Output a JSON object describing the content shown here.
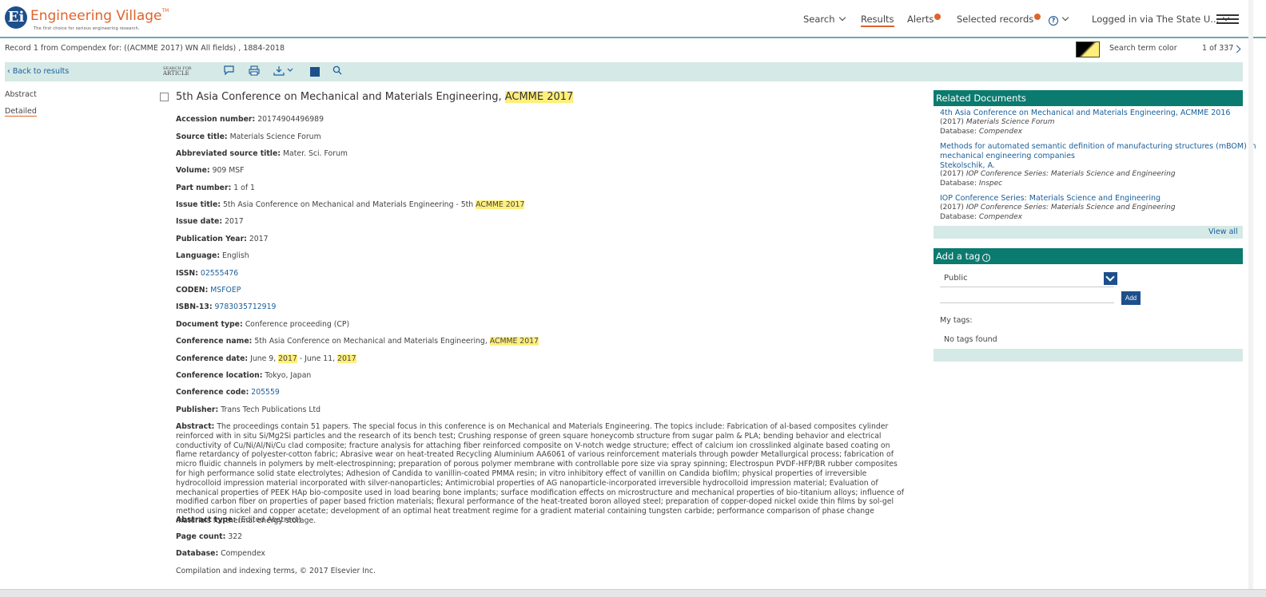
{
  "header": {
    "logo_text": "Engineering Village",
    "logo_mark": "TM",
    "tagline": "The first choice for serious engineering research.",
    "nav": {
      "search": "Search",
      "results": "Results",
      "alerts": "Alerts",
      "selected_records": "Selected records",
      "help": "?",
      "login": "Logged in via The State U..."
    }
  },
  "record_bar": {
    "info": "Record 1 from Compendex for: ((ACMME 2017) WN All fields) , 1884-2018",
    "search_term_color_label": "Search term color",
    "pager": "1 of 337"
  },
  "toolbar": {
    "back": "Back to results",
    "sfx_line1": "SEARCH FOR",
    "sfx_line2": "ARTICLE"
  },
  "left_nav": {
    "abstract": "Abstract",
    "detailed": "Detailed"
  },
  "record": {
    "title": "5th Asia Conference on Mechanical and Materials Engineering, ",
    "title_highlight": "ACMME 2017",
    "fields": [
      {
        "label": "Accession number:",
        "value": "20174904496989"
      },
      {
        "label": "Source title:",
        "value": "Materials Science Forum"
      },
      {
        "label": "Abbreviated source title:",
        "value": "Mater. Sci. Forum"
      },
      {
        "label": "Volume:",
        "value": "909 MSF"
      },
      {
        "label": "Part number:",
        "value": "1 of 1"
      },
      {
        "label": "Issue title:",
        "value": "5th Asia Conference on Mechanical and Materials Engineering - 5th ",
        "highlight": "ACMME 2017"
      },
      {
        "label": "Issue date:",
        "value": "2017"
      },
      {
        "label": "Publication Year:",
        "value": "2017"
      },
      {
        "label": "Language:",
        "value": "English"
      },
      {
        "label": "ISSN:",
        "value": "02555476"
      },
      {
        "label": "CODEN:",
        "value": "MSFOEP"
      },
      {
        "label": "ISBN-13:",
        "value": "9783035712919"
      },
      {
        "label": "Document type:",
        "value": "Conference proceeding (CP)"
      },
      {
        "label": "Conference name:",
        "value": "5th Asia Conference on Mechanical and Materials Engineering, ",
        "highlight": "ACMME 2017"
      },
      {
        "label": "Conference date:",
        "value_a": "June 9, ",
        "hl_a": "2017",
        "value_b": " - June 11, ",
        "hl_b": "2017"
      },
      {
        "label": "Conference location:",
        "value": "Tokyo, Japan"
      },
      {
        "label": "Conference code:",
        "value": "205559"
      },
      {
        "label": "Publisher:",
        "value": "Trans Tech Publications Ltd"
      }
    ],
    "abstract_label": "Abstract:",
    "abstract_text": "The proceedings contain 51 papers. The special focus in this conference is on Mechanical and Materials Engineering. The topics include: Fabrication of al-based composites cylinder reinforced with in situ Si/Mg2Si particles and the research of its bench test; Crushing response of green square honeycomb structure from sugar palm & PLA; bending behavior and electrical conductivity of Cu/Ni/Al/Ni/Cu clad composite; fracture analysis for attaching fiber reinforced composite on V-notch wedge structure; effect of calcium ion crosslinked alginate based coating on flame retardancy of polyester-cotton fabric; Abrasive wear on heat-treated Recycling Aluminium AA6061 of various reinforcement materials through powder Metallurgical process; fabrication of micro fluidic channels in polymers by melt-electrospinning; preparation of porous polymer membrane with controllable pore size via spray spinning; Electrospun PVDF-HFP/BR rubber composites for high performance solid state electrolytes; Adhesion of Candida to vanillin-coated PMMA resin; in vitro inhibitory effect of vanillin on Candida biofilm; physical properties of irreversible hydrocolloid impression material incorporated with silver-nanoparticles; Antimicrobial properties of AG nanoparticle-incorporated irreversible hydrocolloid impression material; Evaluation of mechanical properties of PEEK HAp bio-composite used in load bearing bone implants; surface modification effects on microstructure and mechanical properties of bio-titanium alloys; influence of modified carbon fiber on properties of paper based friction materials; flexural performance of the heat-treated boron alloyed steel; preparation of copper-doped nickel oxide thin films by sol-gel method using nickel and copper acetate; development of an optimal heat treatment regime for a gradient material containing tungsten carbide; performance comparison of phase change materials for thermal energy storage.",
    "abstract_type": {
      "label": "Abstract type:",
      "value": "(Edited Abstract)"
    },
    "page_count": {
      "label": "Page count:",
      "value": "322"
    },
    "database": {
      "label": "Database:",
      "value": "Compendex"
    },
    "copyright": "Compilation and indexing terms, © 2017 Elsevier Inc."
  },
  "related": {
    "heading": "Related Documents",
    "items": [
      {
        "title": "4th Asia Conference on Mechanical and Materials Engineering, ACMME 2016",
        "year": "(2017)",
        "source": "Materials Science Forum",
        "db_label": "Database:",
        "db": "Compendex"
      },
      {
        "title_line1": "Methods for automated semantic definition of manufacturing structures (mBOM) in",
        "title_line2": "mechanical engineering companies",
        "author": "Stekolschik, A.",
        "year": "(2017)",
        "source": "IOP Conference Series: Materials Science and Engineering",
        "db_label": "Database:",
        "db": "Inspec"
      },
      {
        "title": "IOP Conference Series: Materials Science and Engineering",
        "year": "(2017)",
        "source": "IOP Conference Series: Materials Science and Engineering",
        "db_label": "Database:",
        "db": "Compendex"
      }
    ],
    "view_all": "View all"
  },
  "tags": {
    "heading": "Add a tag",
    "visibility": "Public",
    "add_button": "Add",
    "my_tags_label": "My tags:",
    "empty": "No tags found"
  },
  "colors": {
    "accent": "#e0632a",
    "brand": "#1d4f8c",
    "panel": "#0b7a6f",
    "toolbar": "#d5e9e6",
    "highlight": "#ffef7a"
  }
}
